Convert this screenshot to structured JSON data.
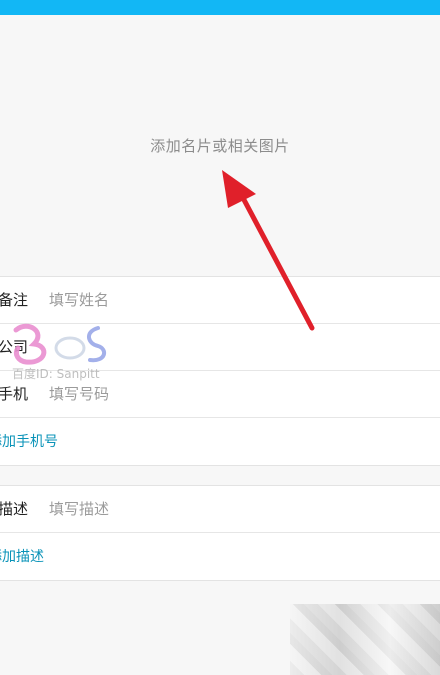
{
  "photo": {
    "label": "添加名片或相关图片"
  },
  "fields": [
    {
      "label": "备注",
      "placeholder": "填写姓名"
    },
    {
      "label": "公司",
      "placeholder": ""
    },
    {
      "label": "手机",
      "placeholder": "填写号码"
    }
  ],
  "add_phone_link": "添加手机号",
  "description": {
    "label": "描述",
    "placeholder": "填写描述"
  },
  "add_description_link": "添加描述",
  "watermark": {
    "text": "百度ID: Sanpitt"
  },
  "colors": {
    "top_bar": "#12b7f5",
    "link": "#0a93b8",
    "arrow": "#e0202a"
  }
}
